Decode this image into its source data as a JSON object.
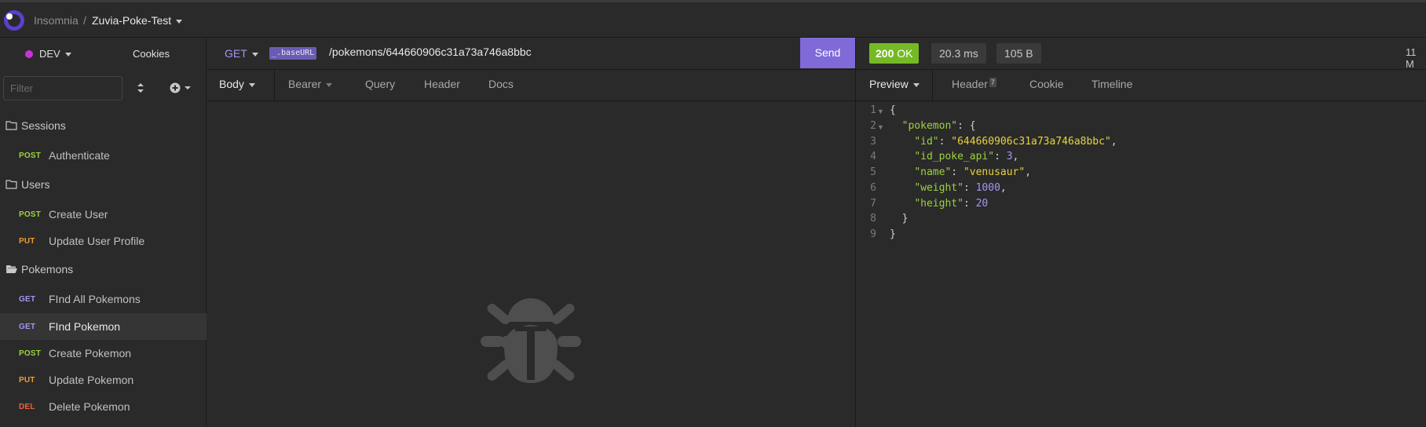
{
  "header": {
    "app_name": "Insomnia",
    "separator": "/",
    "project": "Zuvia-Poke-Test"
  },
  "sidebar": {
    "environment": "DEV",
    "cookies_label": "Cookies",
    "filter_placeholder": "Filter",
    "folders": [
      {
        "label": "Sessions",
        "requests": [
          {
            "method": "POST",
            "name": "Authenticate"
          }
        ]
      },
      {
        "label": "Users",
        "requests": [
          {
            "method": "POST",
            "name": "Create User"
          },
          {
            "method": "PUT",
            "name": "Update User Profile"
          }
        ]
      },
      {
        "label": "Pokemons",
        "requests": [
          {
            "method": "GET",
            "name": "FInd All Pokemons"
          },
          {
            "method": "GET",
            "name": "FInd Pokemon"
          },
          {
            "method": "POST",
            "name": "Create Pokemon"
          },
          {
            "method": "PUT",
            "name": "Update Pokemon"
          },
          {
            "method": "DEL",
            "name": "Delete Pokemon"
          }
        ]
      }
    ]
  },
  "request": {
    "method": "GET",
    "url_variable": "_.baseURL",
    "url_path": "/pokemons/644660906c31a73a746a8bbc",
    "send_label": "Send",
    "tabs": [
      "Body",
      "Bearer",
      "Query",
      "Header",
      "Docs"
    ]
  },
  "response": {
    "status_code": "200",
    "status_text": "OK",
    "time": "20.3 ms",
    "size": "105 B",
    "age": "11 M",
    "tabs": [
      "Preview",
      "Header",
      "Cookie",
      "Timeline"
    ],
    "header_count": "7",
    "line_numbers": [
      "1",
      "2",
      "3",
      "4",
      "5",
      "6",
      "7",
      "8",
      "9"
    ],
    "body": {
      "key_pokemon": "\"pokemon\"",
      "key_id": "\"id\"",
      "val_id": "\"644660906c31a73a746a8bbc\"",
      "key_id_poke_api": "\"id_poke_api\"",
      "val_id_poke_api": "3",
      "key_name": "\"name\"",
      "val_name": "\"venusaur\"",
      "key_weight": "\"weight\"",
      "val_weight": "1000",
      "key_height": "\"height\"",
      "val_height": "20"
    }
  },
  "colors": {
    "accent": "#7f6ad8",
    "method_get": "#a794ef",
    "method_post": "#9bd23d",
    "method_put": "#f29a35",
    "method_del": "#e8643c",
    "status_ok": "#75ba24"
  }
}
